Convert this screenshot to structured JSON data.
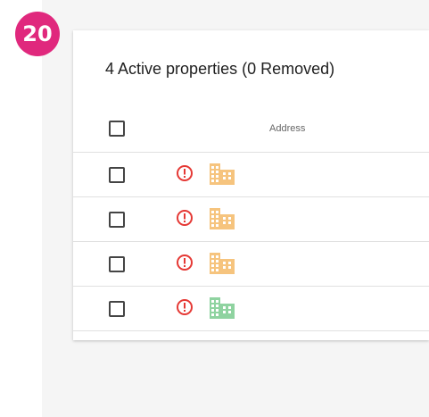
{
  "step_badge": "20",
  "card": {
    "title": "4 Active properties (0 Removed)"
  },
  "table": {
    "columns": [
      "Address"
    ],
    "rows": [
      {
        "status_icon": "alert-circle-icon",
        "building_icon": "building-icon",
        "building_color": "#f6c47e"
      },
      {
        "status_icon": "alert-circle-icon",
        "building_icon": "building-icon",
        "building_color": "#f6c47e"
      },
      {
        "status_icon": "alert-circle-icon",
        "building_icon": "building-icon",
        "building_color": "#f6c47e"
      },
      {
        "status_icon": "alert-circle-icon",
        "building_icon": "building-icon",
        "building_color": "#8fd3a0"
      }
    ]
  },
  "colors": {
    "badge": "#e0287d",
    "alert": "#e53935",
    "building_orange": "#f6c47e",
    "building_green": "#8fd3a0"
  }
}
